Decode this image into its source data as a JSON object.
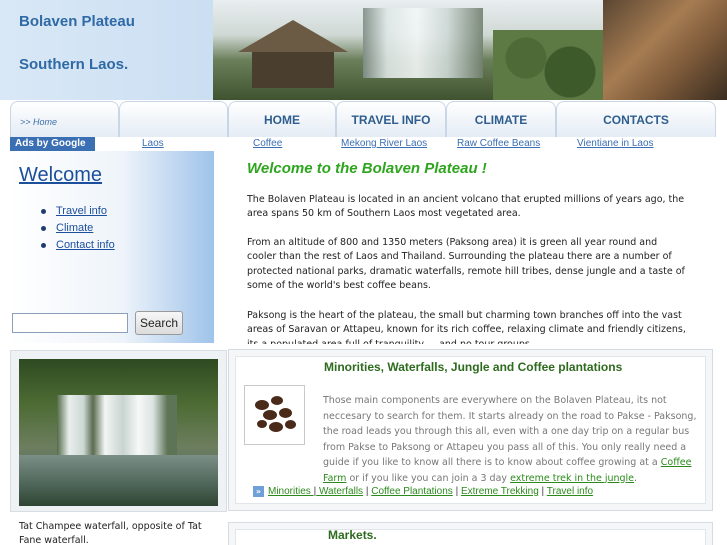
{
  "header": {
    "title": "Bolaven Plateau",
    "subtitle": "Southern Laos."
  },
  "nav": {
    "breadcrumb": ">> Home",
    "tabs": [
      {
        "label": ""
      },
      {
        "label": "HOME"
      },
      {
        "label": "TRAVEL INFO"
      },
      {
        "label": "CLIMATE"
      },
      {
        "label": "CONTACTS"
      }
    ]
  },
  "ads": {
    "label": "Ads by Google",
    "links": [
      "Laos",
      "Coffee",
      "Mekong River Laos",
      "Raw Coffee Beans",
      "Vientiane in Laos"
    ]
  },
  "sidebar": {
    "heading": "Welcome",
    "items": [
      "Travel info",
      "Climate",
      "Contact info"
    ],
    "search": {
      "value": "",
      "button": "Search"
    }
  },
  "main": {
    "title": "Welcome to the Bolaven Plateau !",
    "paragraphs": [
      "The Bolaven Plateau is located in an ancient volcano that erupted millions of years ago, the area spans 50 km of Southern Laos most vegetated area.",
      "From an altitude of 800 and 1350 meters (Paksong area) it is green all year round and cooler than the rest of Laos and Thailand. Surrounding the plateau there are a number of protected national parks, dramatic waterfalls, remote hill tribes, dense jungle and a taste of some of the world's best coffee beans.",
      "Paksong is the heart of the plateau, the small but charming town branches off into the vast areas of Saravan or Attapeu, known for its rich coffee, relaxing climate and friendly citizens, its a populated area full of tranquility ... and no tour groups."
    ]
  },
  "photo": {
    "caption": "Tat Champee waterfall, opposite of Tat Fane waterfall."
  },
  "box1": {
    "title": "Minorities, Waterfalls, Jungle and Coffee plantations",
    "text_before": "Those main components are everywhere on the Bolaven Plateau, its not neccesary to search for them. It starts already on the road to Pakse - Paksong, the road leads you through this all, even with a one day trip on a regular bus from Pakse to Paksong or Attapeu you pass all of this. You only really need a guide if you like to know all there is to know about coffee growing at a ",
    "link1": "Coffee Farm",
    "text_middle": " or if you like you can join a 3 day ",
    "link2": "extreme trek in the jungle",
    "text_after": ".",
    "related": [
      "Minorities ",
      " Waterfalls",
      "Coffee Plantations",
      "Extreme Trekking",
      "Travel info"
    ],
    "separator": "|"
  },
  "box2": {
    "title": "Markets."
  },
  "colors": {
    "accent_blue": "#2f6aa6",
    "title_green": "#2ea51f",
    "link_green": "#2c8a1d"
  }
}
